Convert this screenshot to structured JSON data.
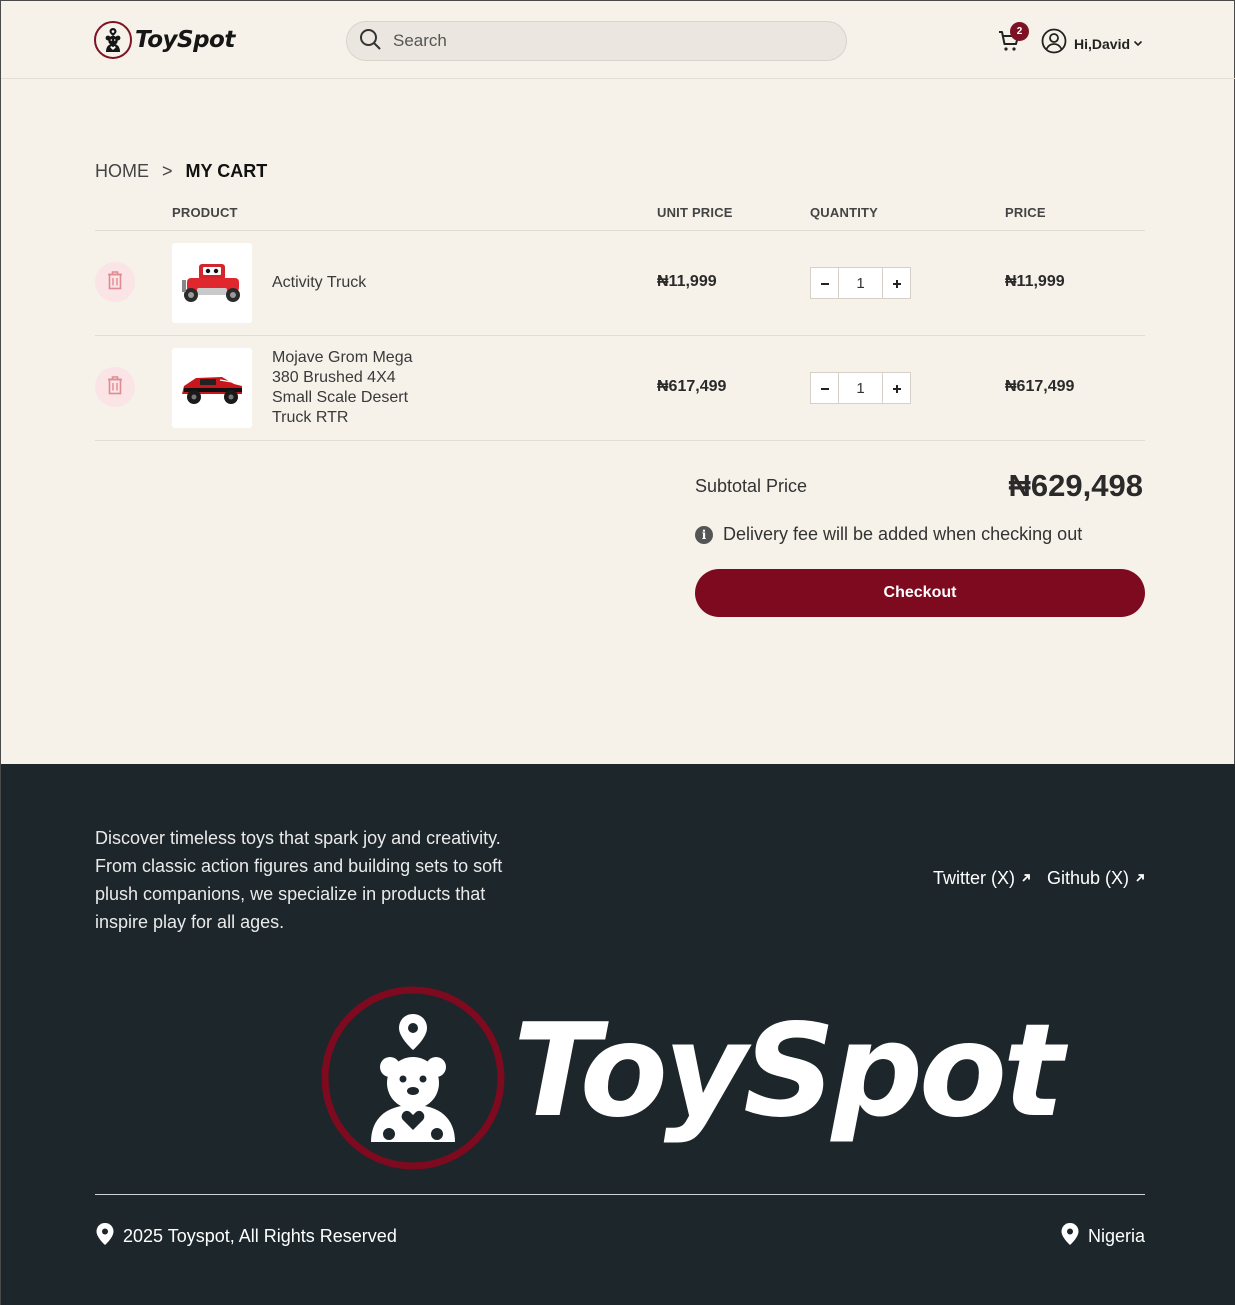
{
  "header": {
    "brand": "ToySpot",
    "search_placeholder": "Search",
    "cart_count": "2",
    "user_greeting": "Hi,David"
  },
  "breadcrumb": {
    "home": "HOME",
    "separator": ">",
    "current": "MY CART"
  },
  "table": {
    "headers": {
      "product": "PRODUCT",
      "unit_price": "UNIT PRICE",
      "quantity": "QUANTITY",
      "price": "PRICE"
    },
    "rows": [
      {
        "name": "Activity Truck",
        "unit_price": "₦11,999",
        "quantity": "1",
        "price": "₦11,999"
      },
      {
        "name_lines": [
          "Mojave Grom Mega",
          "380 Brushed 4X4",
          "Small Scale Desert",
          "Truck RTR"
        ],
        "unit_price": "₦617,499",
        "quantity": "1",
        "price": "₦617,499"
      }
    ]
  },
  "summary": {
    "subtotal_label": "Subtotal Price",
    "subtotal_value": "₦629,498",
    "delivery_note": "Delivery fee will be added when checking out",
    "checkout_label": "Checkout"
  },
  "footer": {
    "about": "Discover timeless toys that spark joy and creativity. From classic action figures and building sets to soft plush companions, we specialize in products that inspire play for all ages.",
    "links": [
      "Twitter (X)",
      "Github (X)"
    ],
    "brand": "ToySpot",
    "copyright": "2025 Toyspot, All Rights Reserved",
    "country": "Nigeria"
  },
  "colors": {
    "background": "#f6f1e9",
    "accent": "#7d0a1f",
    "footer_bg": "#1d262b"
  },
  "icons": [
    "search-icon",
    "cart-icon",
    "user-icon",
    "chevron-down-icon",
    "trash-icon",
    "minus-icon",
    "plus-icon",
    "info-icon",
    "external-link-icon",
    "location-pin-icon"
  ]
}
